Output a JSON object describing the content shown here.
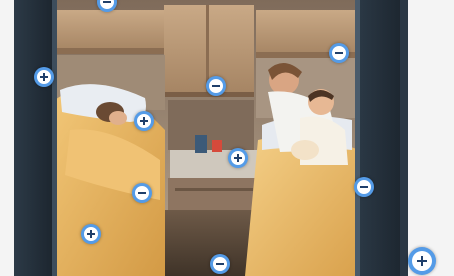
{
  "colors": {
    "hotspot_ring": "#4b96e6",
    "hotspot_fill": "#ffffff",
    "glyph": "#1f3f6b",
    "door_frame": "#1f2a35",
    "wood": "#b99777",
    "bedding": "#e8b667",
    "pillow": "#e9edf2"
  },
  "image": {
    "semantic": "photo-two-beds-caravan-interior"
  },
  "hotspots": [
    {
      "icon": "minus-icon",
      "state": "open"
    },
    {
      "icon": "plus-icon",
      "state": "closed"
    },
    {
      "icon": "minus-icon",
      "state": "open"
    },
    {
      "icon": "minus-icon",
      "state": "open"
    },
    {
      "icon": "plus-icon",
      "state": "closed"
    },
    {
      "icon": "plus-icon",
      "state": "closed"
    },
    {
      "icon": "minus-icon",
      "state": "open"
    },
    {
      "icon": "minus-icon",
      "state": "open"
    },
    {
      "icon": "plus-icon",
      "state": "closed"
    },
    {
      "icon": "minus-icon",
      "state": "open"
    },
    {
      "icon": "plus-icon",
      "state": "closed"
    }
  ]
}
